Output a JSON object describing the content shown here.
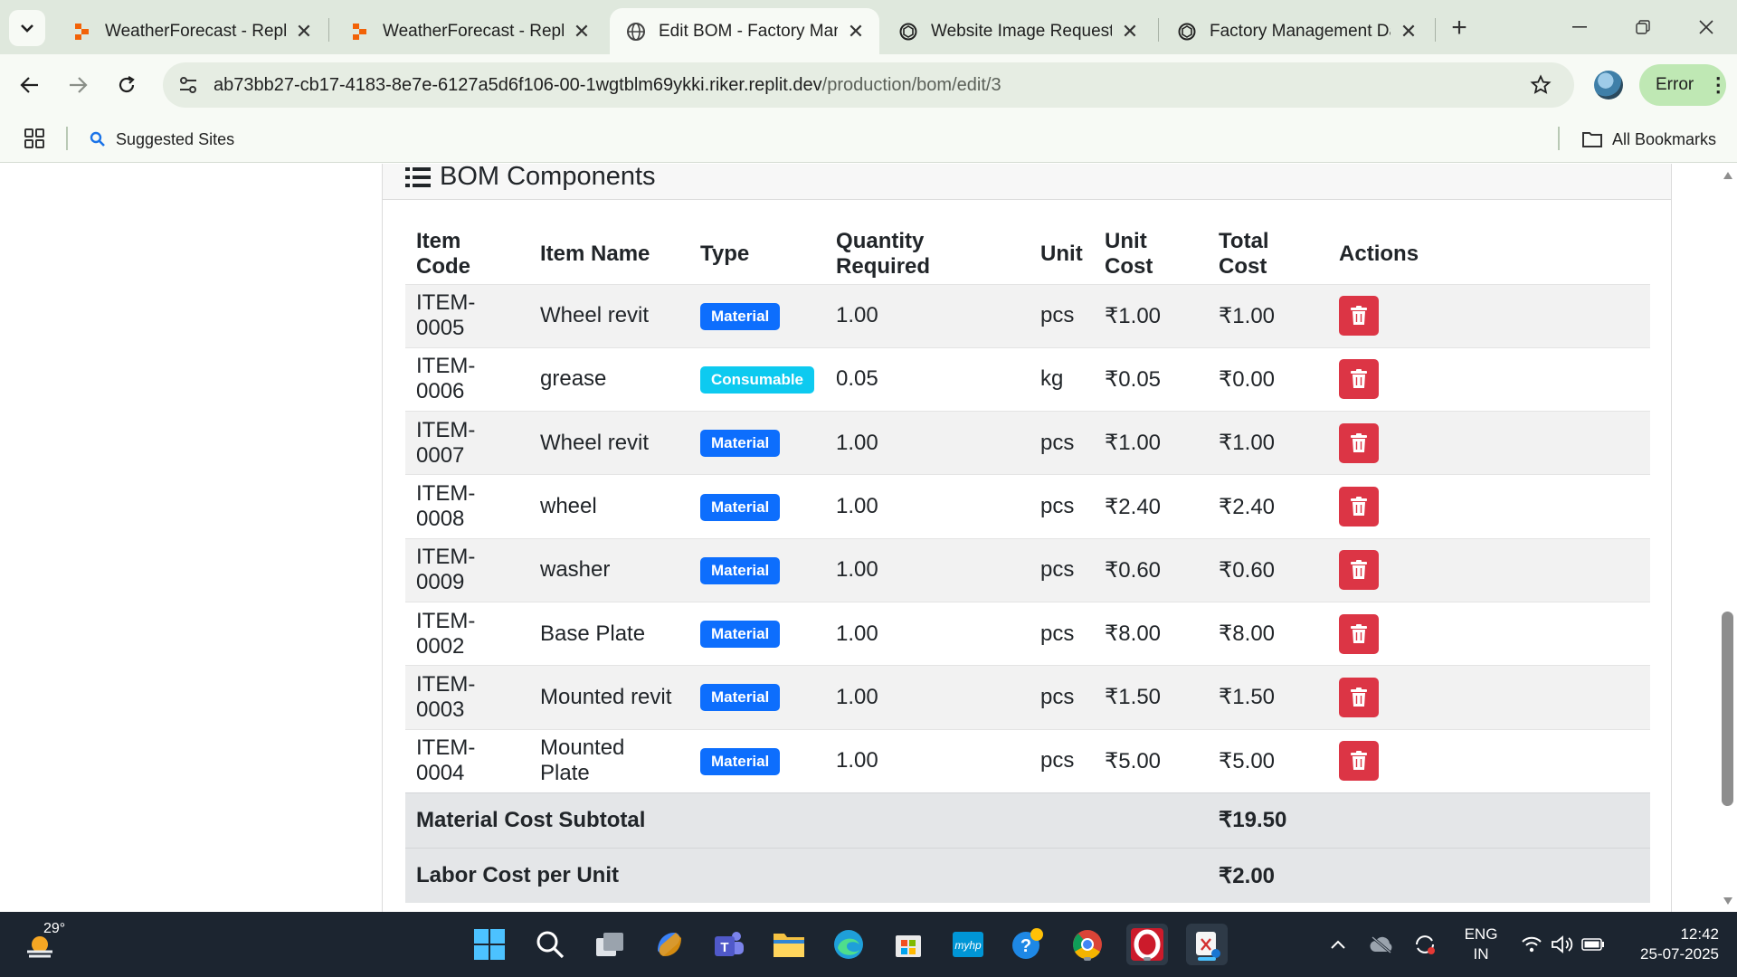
{
  "browser": {
    "tabs": [
      {
        "title": "WeatherForecast - Replit",
        "favicon": "replit-icon",
        "active": false
      },
      {
        "title": "WeatherForecast - Replit",
        "favicon": "replit-icon",
        "active": false
      },
      {
        "title": "Edit BOM - Factory Mana",
        "favicon": "globe-icon",
        "active": true
      },
      {
        "title": "Website Image Request",
        "favicon": "openai-icon",
        "active": false
      },
      {
        "title": "Factory Management Dat",
        "favicon": "openai-icon",
        "active": false
      }
    ],
    "url_host": "ab73bb27-cb17-4183-8e7e-6127a5d6f106-00-1wgtblm69ykki.riker.replit.dev",
    "url_path": "/production/bom/edit/3",
    "profile_status": "Error",
    "bookmarks": {
      "suggested": "Suggested Sites",
      "all": "All Bookmarks"
    }
  },
  "page": {
    "section_title": "BOM Components",
    "columns": [
      "Item Code",
      "Item Name",
      "Type",
      "Quantity Required",
      "Unit",
      "Unit Cost",
      "Total Cost",
      "Actions"
    ],
    "rows": [
      {
        "code": "ITEM-0005",
        "name": "Wheel revit",
        "type": "Material",
        "qty": "1.00",
        "unit": "pcs",
        "unit_cost": "₹1.00",
        "total": "₹1.00"
      },
      {
        "code": "ITEM-0006",
        "name": "grease",
        "type": "Consumable",
        "qty": "0.05",
        "unit": "kg",
        "unit_cost": "₹0.05",
        "total": "₹0.00"
      },
      {
        "code": "ITEM-0007",
        "name": "Wheel revit",
        "type": "Material",
        "qty": "1.00",
        "unit": "pcs",
        "unit_cost": "₹1.00",
        "total": "₹1.00"
      },
      {
        "code": "ITEM-0008",
        "name": "wheel",
        "type": "Material",
        "qty": "1.00",
        "unit": "pcs",
        "unit_cost": "₹2.40",
        "total": "₹2.40"
      },
      {
        "code": "ITEM-0009",
        "name": "washer",
        "type": "Material",
        "qty": "1.00",
        "unit": "pcs",
        "unit_cost": "₹0.60",
        "total": "₹0.60"
      },
      {
        "code": "ITEM-0002",
        "name": "Base Plate",
        "type": "Material",
        "qty": "1.00",
        "unit": "pcs",
        "unit_cost": "₹8.00",
        "total": "₹8.00"
      },
      {
        "code": "ITEM-0003",
        "name": "Mounted revit",
        "type": "Material",
        "qty": "1.00",
        "unit": "pcs",
        "unit_cost": "₹1.50",
        "total": "₹1.50"
      },
      {
        "code": "ITEM-0004",
        "name": "Mounted Plate",
        "type": "Material",
        "qty": "1.00",
        "unit": "pcs",
        "unit_cost": "₹5.00",
        "total": "₹5.00"
      }
    ],
    "summary": [
      {
        "label": "Material Cost Subtotal",
        "value": "₹19.50"
      },
      {
        "label": "Labor Cost per Unit",
        "value": "₹2.00"
      }
    ],
    "colors": {
      "material_badge": "#0d6efd",
      "consumable_badge": "#0dcaf0",
      "delete_button": "#dc3545"
    }
  },
  "taskbar": {
    "temperature": "29°",
    "language": "ENG",
    "region": "IN",
    "time": "12:42",
    "date": "25-07-2025"
  }
}
